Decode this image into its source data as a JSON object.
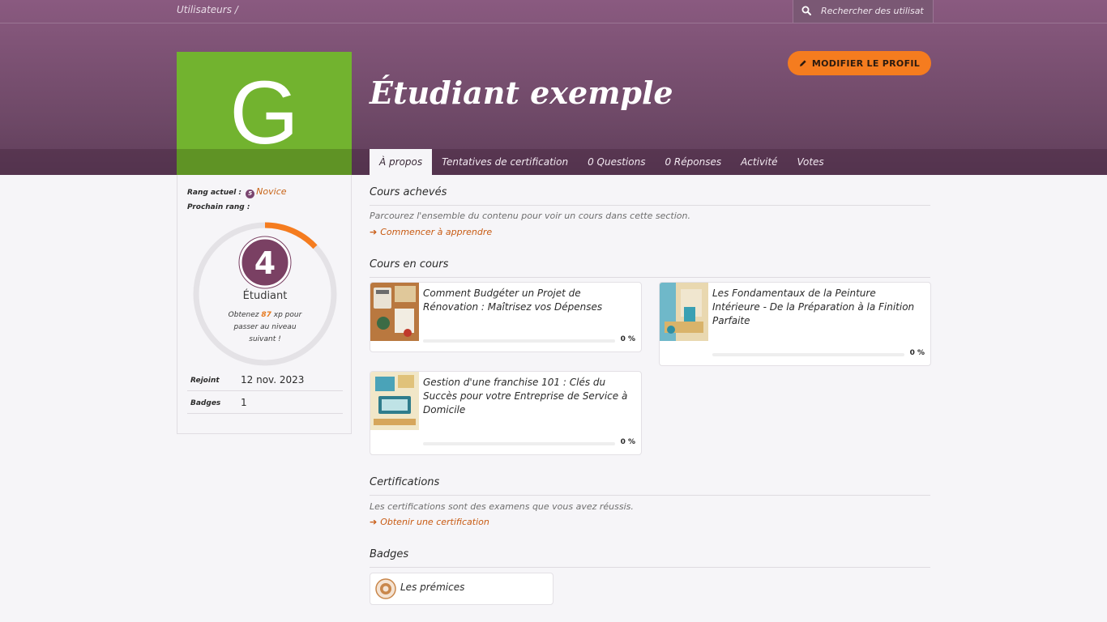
{
  "topbar": {
    "breadcrumb": "Utilisateurs /",
    "search_placeholder": "Rechercher des utilisat"
  },
  "profile": {
    "avatar_letter": "G",
    "avatar_color": "#72b32f",
    "name": "Étudiant exemple",
    "edit_label": "MODIFIER LE PROFIL"
  },
  "tabs": [
    "À propos",
    "Tentatives de certification",
    "0 Questions",
    "0 Réponses",
    "Activité",
    "Votes"
  ],
  "sidebar": {
    "current_rank_label": "Rang actuel :",
    "current_rank_badge": "5",
    "current_rank": "Novice",
    "next_rank_label": "Prochain rang :",
    "level": "4",
    "level_title": "Étudiant",
    "xp_prefix": "Obtenez",
    "xp_value": "87",
    "xp_suffix": "xp pour passer au niveau suivant !",
    "xp_progress_percent": 13,
    "meta": [
      {
        "key": "Rejoint",
        "value": "12 nov. 2023"
      },
      {
        "key": "Badges",
        "value": "1"
      }
    ]
  },
  "completed": {
    "title": "Cours achevés",
    "text": "Parcourez l'ensemble du contenu pour voir un cours dans cette section.",
    "link": "Commencer à apprendre"
  },
  "in_progress": {
    "title": "Cours en cours",
    "courses": [
      {
        "title": "Comment Budgéter un Projet de Rénovation : Maîtrisez vos Dépenses",
        "progress": "0 %"
      },
      {
        "title": "Les Fondamentaux de la Peinture Intérieure - De la Préparation à la Finition Parfaite",
        "progress": "0 %"
      },
      {
        "title": "Gestion d'une franchise 101 : Clés du Succès pour votre Entreprise de Service à Domicile",
        "progress": "0 %"
      }
    ]
  },
  "certifications": {
    "title": "Certifications",
    "text": "Les certifications sont des examens que vous avez réussis.",
    "link": "Obtenir une certification"
  },
  "badges": {
    "title": "Badges",
    "items": [
      {
        "name": "Les prémices"
      }
    ]
  },
  "colors": {
    "header": "#7a4f73",
    "accent": "#f57c1f",
    "link": "#c85a12"
  }
}
